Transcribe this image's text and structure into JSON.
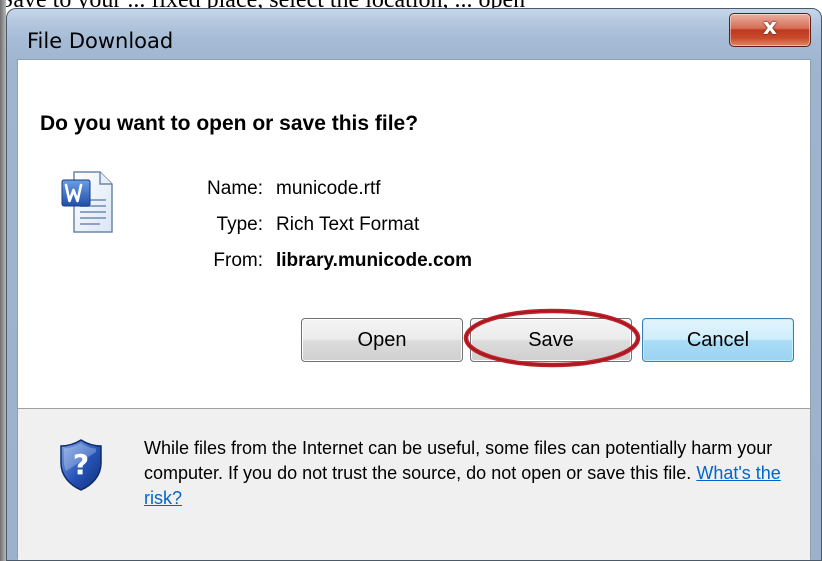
{
  "background_text": "Save to your ... fixed place, select the location, ... open",
  "window": {
    "title": "File Download",
    "close_glyph": "x"
  },
  "prompt": {
    "heading": "Do you want to open or save this file?"
  },
  "file": {
    "icon": "word-document-icon",
    "name_label": "Name:",
    "name_value": "municode.rtf",
    "type_label": "Type:",
    "type_value": "Rich Text Format",
    "from_label": "From:",
    "from_value": "library.municode.com"
  },
  "buttons": {
    "open": "Open",
    "save": "Save",
    "cancel": "Cancel"
  },
  "annotation": {
    "highlight_color": "#c0202a",
    "target": "save-button"
  },
  "warning": {
    "icon": "security-shield-question-icon",
    "text_before_link": "While files from the Internet can be useful, some files can potentially harm your computer. If you do not trust the source, do not open or save this file.",
    "link_text": "What's the risk?"
  },
  "colors": {
    "close_button": "#c74a2d",
    "default_button_accent": "#3c7fb1",
    "link": "#0066cc"
  }
}
